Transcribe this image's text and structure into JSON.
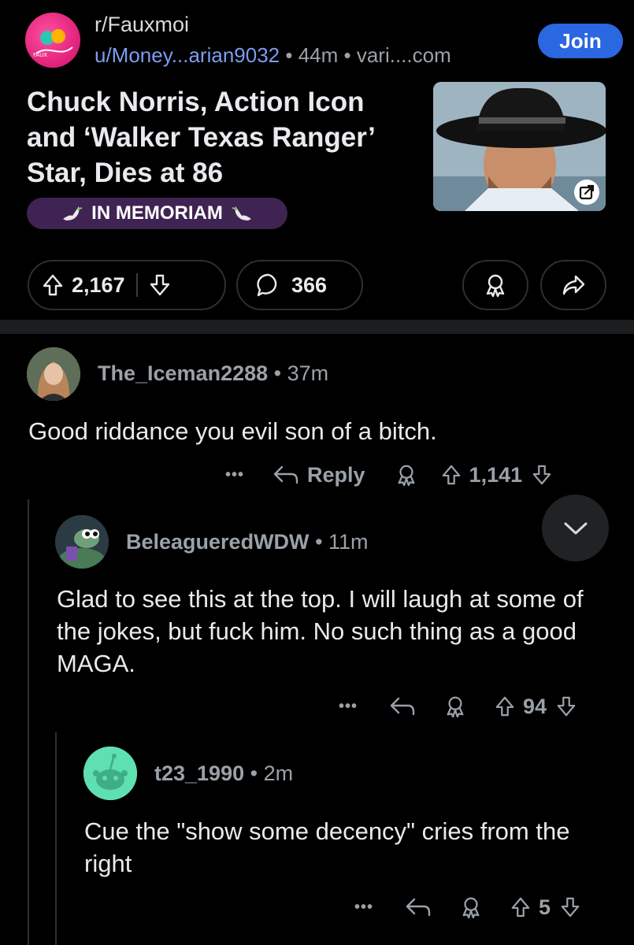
{
  "post": {
    "subreddit": "r/Fauxmoi",
    "subreddit_avatar_text": "FAUX",
    "author": "u/Money...arian9032",
    "age": "44m",
    "domain": "vari....com",
    "join_label": "Join",
    "title": "Chuck Norris, Action Icon and ‘Walker Texas Ranger’ Star, Dies at 86",
    "flair": "IN MEMORIAM",
    "upvotes": "2,167",
    "comments": "366"
  },
  "comments": [
    {
      "user": "The_Iceman2288",
      "age": "37m",
      "body": "Good riddance you evil son of a bitch.",
      "more": "•••",
      "reply_label": "Reply",
      "score": "1,141"
    },
    {
      "user": "BeleagueredWDW",
      "age": "11m",
      "body": "Glad to see this at the top. I will laugh at some of the jokes, but fuck him. No such thing as a good MAGA.",
      "more": "•••",
      "score": "94"
    },
    {
      "user": "t23_1990",
      "age": "2m",
      "body": "Cue the \"show some decency\" cries from the right",
      "more": "•••",
      "score": "5"
    }
  ],
  "colors": {
    "background": "#000000",
    "join_button": "#2a67e0",
    "username_link": "#7b9cf0",
    "flair_bg": "#3f2352",
    "subreddit_avatar": "#e0207a"
  }
}
